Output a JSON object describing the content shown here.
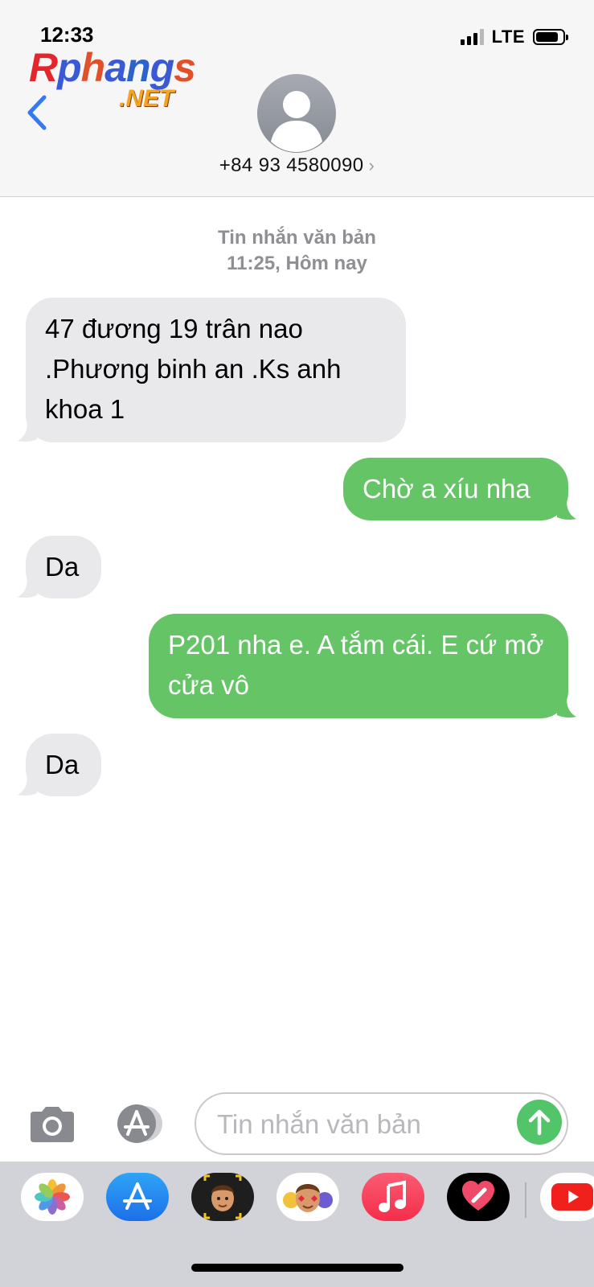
{
  "status_bar": {
    "time": "12:33",
    "network": "LTE"
  },
  "watermark": {
    "main": "Rphangs",
    "sub": ".NET"
  },
  "header": {
    "contact": "+84 93 4580090"
  },
  "thread": {
    "service": "Tin nhắn văn bản",
    "time_prefix": "11:25, ",
    "time_day": "Hôm nay",
    "messages": [
      {
        "from": "them",
        "text": "47 đương 19 trân nao .Phương binh an .Ks anh khoa 1"
      },
      {
        "from": "me",
        "text": "Chờ a xíu nha"
      },
      {
        "from": "them",
        "text": "Da"
      },
      {
        "from": "me",
        "text": "P201 nha e. A tắm cái. E cứ mở cửa vô"
      },
      {
        "from": "them",
        "text": "Da"
      }
    ]
  },
  "composer": {
    "placeholder": "Tin nhắn văn bản",
    "value": ""
  },
  "app_drawer": {
    "apps": [
      "photos-icon",
      "app-store-icon",
      "memoji-icon",
      "animoji-stickers-icon",
      "music-icon",
      "digital-touch-icon",
      "youtube-icon"
    ]
  },
  "colors": {
    "outgoing": "#65c466",
    "incoming": "#e9e9eb",
    "accent": "#3478f6",
    "send": "#52c56a"
  }
}
